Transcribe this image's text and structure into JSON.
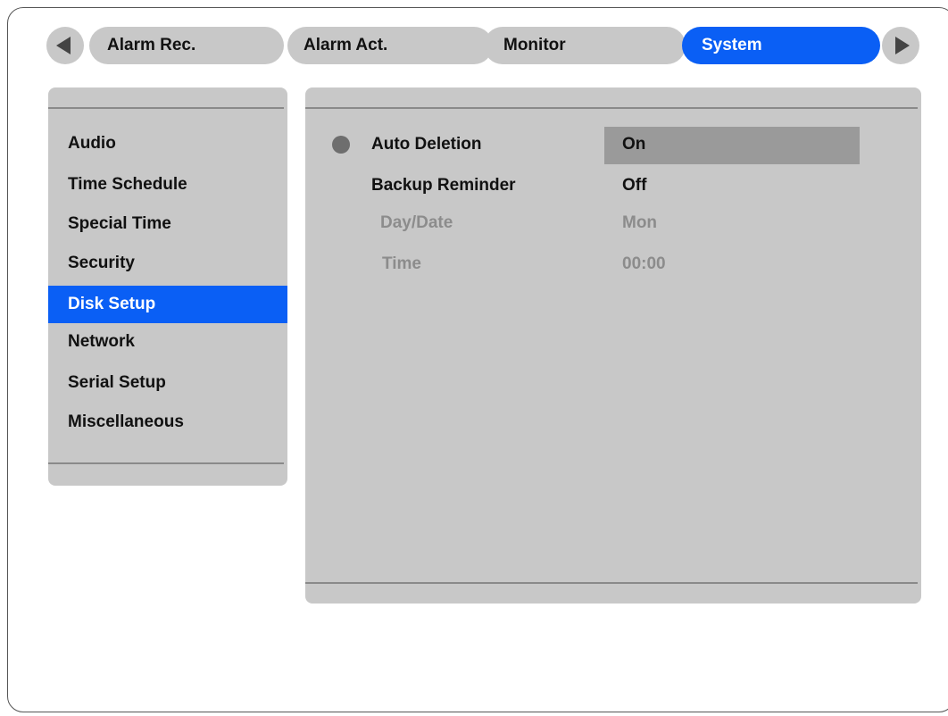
{
  "tabs": [
    {
      "label": "Alarm Rec."
    },
    {
      "label": "Alarm Act."
    },
    {
      "label": "Monitor"
    },
    {
      "label": "System"
    }
  ],
  "sidebar": {
    "items": [
      {
        "label": "Audio"
      },
      {
        "label": "Time Schedule"
      },
      {
        "label": "Special Time"
      },
      {
        "label": "Security"
      },
      {
        "label": "Disk Setup"
      },
      {
        "label": "Network"
      },
      {
        "label": "Serial Setup"
      },
      {
        "label": "Miscellaneous"
      }
    ],
    "selected": "Disk Setup"
  },
  "settings": {
    "auto_deletion": {
      "label": "Auto Deletion",
      "value": "On"
    },
    "backup_reminder": {
      "label": "Backup Reminder",
      "value": "Off"
    },
    "day_date": {
      "label": "Day/Date",
      "value": "Mon"
    },
    "time": {
      "label": "Time",
      "value": "00:00"
    }
  },
  "colors": {
    "accent": "#0a5ff5",
    "panel": "#c8c8c8",
    "disabled_text": "#8c8c8c"
  },
  "icons": {
    "prev": "left-arrow-icon",
    "next": "right-arrow-icon",
    "bullet": "bullet-icon"
  }
}
